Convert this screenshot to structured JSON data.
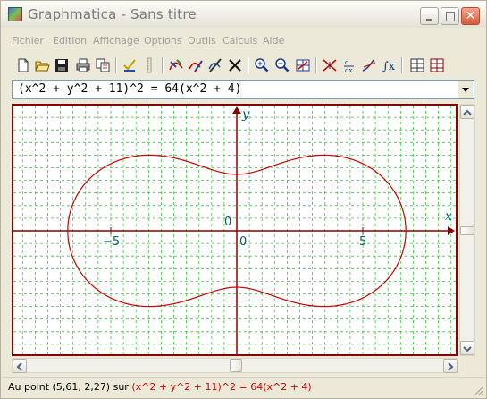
{
  "window": {
    "title": "Graphmatica - Sans titre"
  },
  "menu": [
    "Fichier",
    "Edition",
    "Affichage",
    "Options",
    "Outils",
    "Calculs",
    "Aide"
  ],
  "toolbar": {
    "icons": [
      "new-file-icon",
      "open-folder-icon",
      "save-disk-icon",
      "print-icon",
      "copy-icon",
      "check-icon",
      "ruler-icon",
      "graph-edit-icon",
      "graph-pen-icon",
      "graph-erase-icon",
      "close-x-icon",
      "zoom-in-icon",
      "zoom-out-icon",
      "grid-icon",
      "intersection-icon",
      "derivative-icon",
      "tangent-icon",
      "integral-icon",
      "table-icon",
      "data-table-icon"
    ]
  },
  "equation": {
    "value": "(x^2 + y^2 + 11)^2 = 64(x^2 + 4)"
  },
  "graph": {
    "x_axis_label": "x",
    "y_axis_label": "y",
    "tick_labels": {
      "x_neg5": "−5",
      "x_0": "0",
      "x_5": "5",
      "y_0": "0"
    },
    "x_range": [
      -8.5,
      8.5
    ],
    "y_range": [
      -4.8,
      4.8
    ],
    "grid": true,
    "colors": {
      "curve": "#CC0000",
      "axes": "#8B0000",
      "grid": "#33CC33",
      "tick_label": "#006666",
      "axis_label": "#006666"
    },
    "curve_equation": {
      "a": 11,
      "b": 64,
      "c": 4
    }
  },
  "status": {
    "prefix": "Au point (5,61, 2,27) sur",
    "equation": "(x^2 + y^2 + 11)^2 = 64(x^2 + 4)"
  }
}
